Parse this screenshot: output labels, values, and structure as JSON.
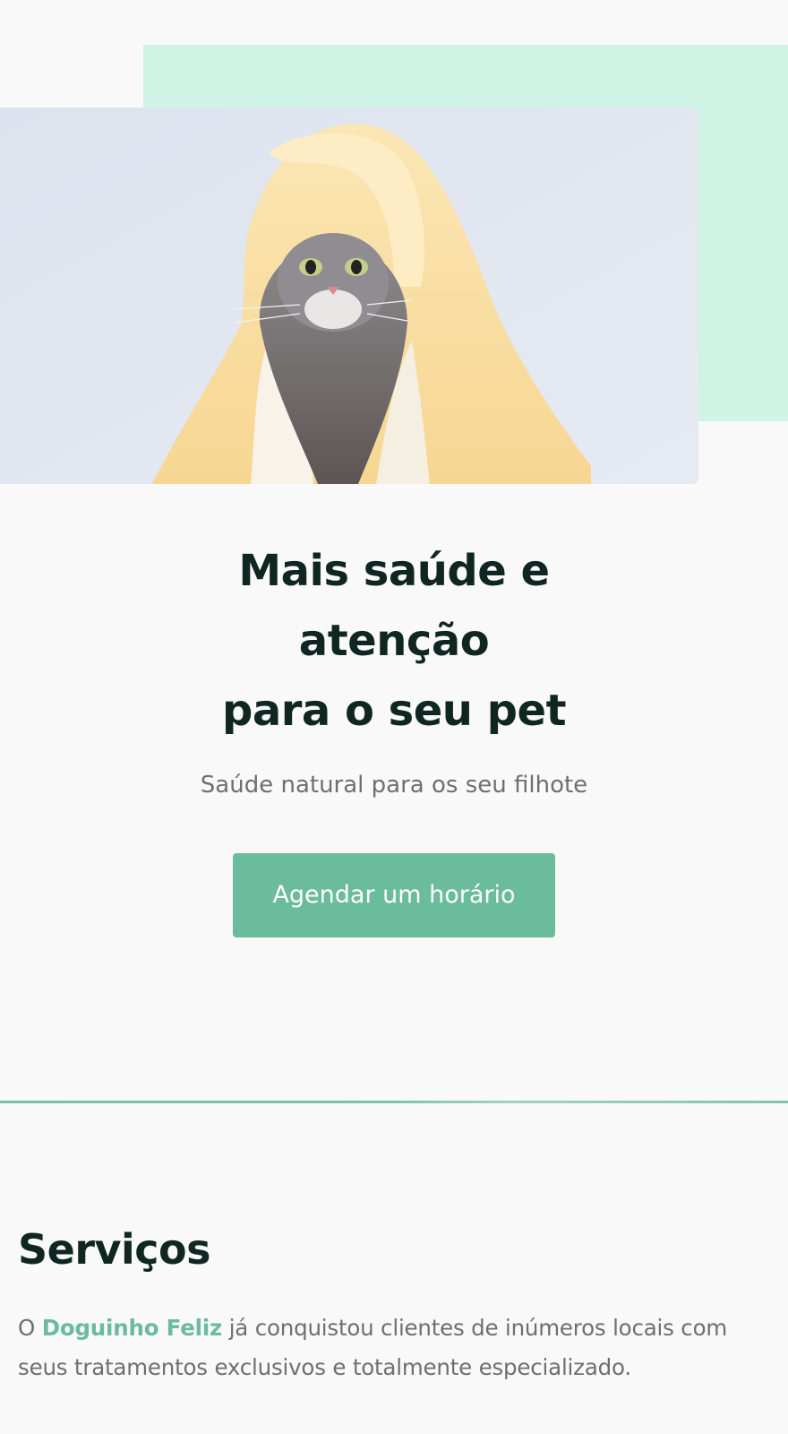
{
  "hero": {
    "title_line1": "Mais saúde e",
    "title_line2": "atenção",
    "title_line3": "para o seu pet",
    "subtitle": "Saúde natural para os seu filhote",
    "cta_label": "Agendar um horário",
    "image_icon": "cat-in-towel-photo"
  },
  "services": {
    "title": "Serviços",
    "intro_prefix": "O",
    "brand_name": "Doguinho Feliz",
    "intro_suffix": "já conquistou clientes de inúmeros locais com seus tratamentos exclusivos e totalmente especializado."
  },
  "colors": {
    "accent": "#6bbb9d",
    "mint_background": "#cff3e5",
    "heading": "#0f2720",
    "body_text": "#6f6f6f",
    "page_background": "#f9f9f9"
  }
}
